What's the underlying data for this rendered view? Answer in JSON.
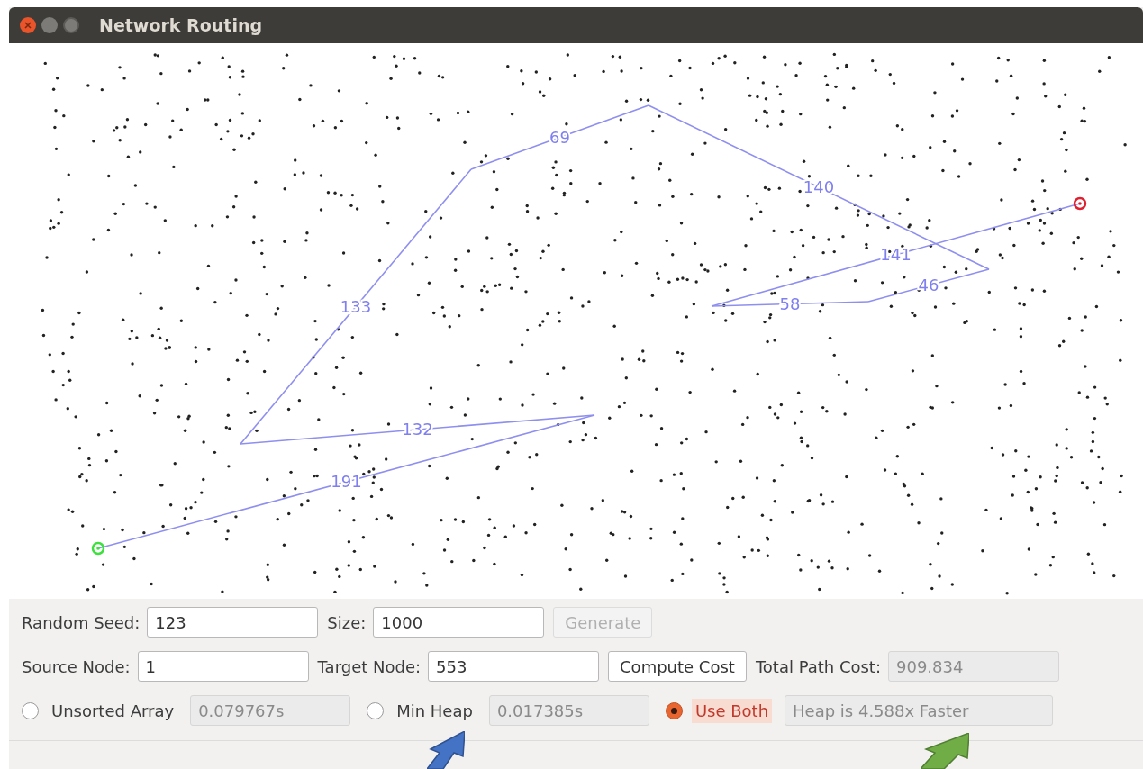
{
  "window": {
    "title": "Network Routing"
  },
  "graph": {
    "edges": [
      {
        "weight": "191"
      },
      {
        "weight": "132"
      },
      {
        "weight": "133"
      },
      {
        "weight": "69"
      },
      {
        "weight": "140"
      },
      {
        "weight": "46"
      },
      {
        "weight": "58"
      },
      {
        "weight": "141"
      }
    ]
  },
  "rows": [
    {
      "items": [
        {
          "kind": "field",
          "label": "Random Seed:",
          "value": "123"
        },
        {
          "kind": "field",
          "label": "Size:",
          "value": "1000"
        },
        {
          "kind": "button",
          "label": "Generate",
          "disabled": true
        }
      ]
    },
    {
      "items": [
        {
          "kind": "field",
          "label": "Source Node:",
          "value": "1"
        },
        {
          "kind": "field",
          "label": "Target Node:",
          "value": "553"
        },
        {
          "kind": "button",
          "label": "Compute Cost",
          "disabled": false
        },
        {
          "kind": "readout",
          "label": "Total Path Cost:",
          "value": "909.834"
        }
      ]
    }
  ],
  "modes": [
    {
      "label": "Unsorted Array",
      "selected": false,
      "result": "0.079767s"
    },
    {
      "label": "Min Heap",
      "selected": false,
      "result": "0.017385s"
    },
    {
      "label": "Use Both",
      "selected": true,
      "result": "Heap is 4.588x Faster"
    }
  ]
}
